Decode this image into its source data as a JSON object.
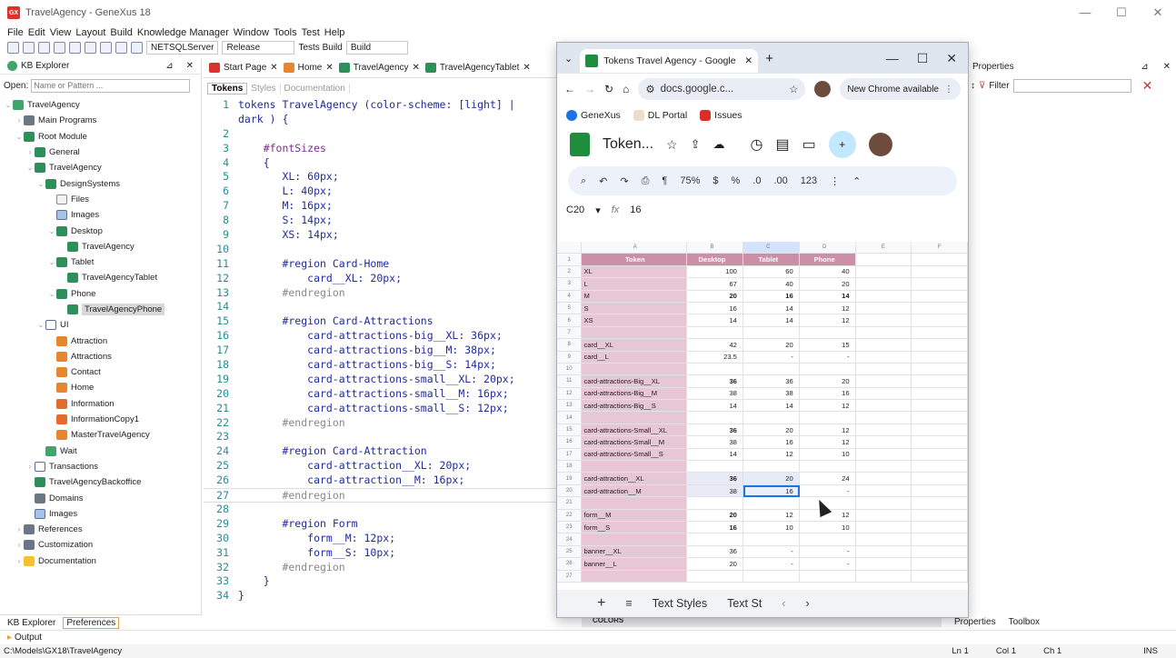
{
  "window": {
    "title": "TravelAgency - GeneXus 18",
    "app_icon": "GX"
  },
  "menu": [
    "File",
    "Edit",
    "View",
    "Layout",
    "Build",
    "Knowledge Manager",
    "Window",
    "Tools",
    "Test",
    "Help"
  ],
  "toolbar": {
    "server": "NETSQLServer",
    "config": "Release",
    "build": "Tests Build",
    "build_sel": "Build"
  },
  "kb_explorer": {
    "title": "KB Explorer",
    "open_label": "Open:",
    "open_placeholder": "Name or Pattern ...",
    "tree": [
      {
        "label": "TravelAgency",
        "level": 0,
        "icon": "kb-icon",
        "chev": "⌄"
      },
      {
        "label": "Main Programs",
        "level": 1,
        "icon": "main-programs-icon",
        "chev": "›"
      },
      {
        "label": "Root Module",
        "level": 1,
        "icon": "module-icon",
        "chev": "⌄"
      },
      {
        "label": "General",
        "level": 2,
        "icon": "module-icon",
        "chev": "›"
      },
      {
        "label": "TravelAgency",
        "level": 2,
        "icon": "module-icon",
        "chev": "⌄"
      },
      {
        "label": "DesignSystems",
        "level": 3,
        "icon": "module-icon",
        "chev": "⌄"
      },
      {
        "label": "Files",
        "level": 4,
        "icon": "file-icon",
        "chev": ""
      },
      {
        "label": "Images",
        "level": 4,
        "icon": "image-icon",
        "chev": ""
      },
      {
        "label": "Desktop",
        "level": 4,
        "icon": "module-icon",
        "chev": "⌄"
      },
      {
        "label": "TravelAgency",
        "level": 5,
        "icon": "design-system-icon",
        "chev": ""
      },
      {
        "label": "Tablet",
        "level": 4,
        "icon": "module-icon",
        "chev": "⌄"
      },
      {
        "label": "TravelAgencyTablet",
        "level": 5,
        "icon": "design-system-icon",
        "chev": ""
      },
      {
        "label": "Phone",
        "level": 4,
        "icon": "module-icon",
        "chev": "⌄"
      },
      {
        "label": "TravelAgencyPhone",
        "level": 5,
        "icon": "design-system-icon",
        "chev": "",
        "selected": true
      },
      {
        "label": "UI",
        "level": 3,
        "icon": "folder-icon",
        "chev": "⌄"
      },
      {
        "label": "Attraction",
        "level": 4,
        "icon": "panel-icon",
        "chev": ""
      },
      {
        "label": "Attractions",
        "level": 4,
        "icon": "panel-icon",
        "chev": ""
      },
      {
        "label": "Contact",
        "level": 4,
        "icon": "panel-icon",
        "chev": ""
      },
      {
        "label": "Home",
        "level": 4,
        "icon": "panel-icon",
        "chev": ""
      },
      {
        "label": "Information",
        "level": 4,
        "icon": "information-icon",
        "chev": ""
      },
      {
        "label": "InformationCopy1",
        "level": 4,
        "icon": "information-icon",
        "chev": ""
      },
      {
        "label": "MasterTravelAgency",
        "level": 4,
        "icon": "panel-icon",
        "chev": ""
      },
      {
        "label": "Wait",
        "level": 3,
        "icon": "wait-icon",
        "chev": ""
      },
      {
        "label": "Transactions",
        "level": 2,
        "icon": "folder-icon",
        "chev": "›"
      },
      {
        "label": "TravelAgencyBackoffice",
        "level": 2,
        "icon": "design-system-icon",
        "chev": ""
      },
      {
        "label": "Domains",
        "level": 2,
        "icon": "domains-icon",
        "chev": ""
      },
      {
        "label": "Images",
        "level": 2,
        "icon": "image-icon",
        "chev": ""
      },
      {
        "label": "References",
        "level": 1,
        "icon": "references-icon",
        "chev": "›"
      },
      {
        "label": "Customization",
        "level": 1,
        "icon": "customization-icon",
        "chev": "›"
      },
      {
        "label": "Documentation",
        "level": 1,
        "icon": "documentation-icon",
        "chev": "›"
      }
    ],
    "bottom_tabs": [
      "KB Explorer",
      "Preferences"
    ]
  },
  "editor": {
    "tabs": [
      "Start Page",
      "Home",
      "TravelAgency",
      "TravelAgencyTablet"
    ],
    "sub_tabs": [
      "Tokens",
      "Styles",
      "Documentation"
    ],
    "lines": [
      {
        "n": "1",
        "t": "tokens TravelAgency (color-scheme: [light] |",
        "c": false
      },
      {
        "n": "",
        "t": "dark ) {",
        "c": false
      },
      {
        "n": "2",
        "t": "",
        "c": false
      },
      {
        "n": "3",
        "t": "    #fontSizes",
        "c": false,
        "kw": true
      },
      {
        "n": "4",
        "t": "    {",
        "c": false
      },
      {
        "n": "5",
        "t": "       XL: 60px;",
        "c": false
      },
      {
        "n": "6",
        "t": "       L: 40px;",
        "c": false
      },
      {
        "n": "7",
        "t": "       M: 16px;",
        "c": false
      },
      {
        "n": "8",
        "t": "       S: 14px;",
        "c": false
      },
      {
        "n": "9",
        "t": "       XS: 14px;",
        "c": false
      },
      {
        "n": "10",
        "t": "",
        "c": false
      },
      {
        "n": "11",
        "t": "       #region Card-Home",
        "c": false
      },
      {
        "n": "12",
        "t": "           card__XL: 20px;",
        "c": false
      },
      {
        "n": "13",
        "t": "       #endregion",
        "c": true
      },
      {
        "n": "14",
        "t": "",
        "c": false
      },
      {
        "n": "15",
        "t": "       #region Card-Attractions",
        "c": false
      },
      {
        "n": "16",
        "t": "           card-attractions-big__XL: 36px;",
        "c": false
      },
      {
        "n": "17",
        "t": "           card-attractions-big__M: 38px;",
        "c": false
      },
      {
        "n": "18",
        "t": "           card-attractions-big__S: 14px;",
        "c": false
      },
      {
        "n": "19",
        "t": "           card-attractions-small__XL: 20px;",
        "c": false
      },
      {
        "n": "20",
        "t": "           card-attractions-small__M: 16px;",
        "c": false
      },
      {
        "n": "21",
        "t": "           card-attractions-small__S: 12px;",
        "c": false
      },
      {
        "n": "22",
        "t": "       #endregion",
        "c": true
      },
      {
        "n": "23",
        "t": "",
        "c": false
      },
      {
        "n": "24",
        "t": "       #region Card-Attraction",
        "c": false
      },
      {
        "n": "25",
        "t": "           card-attraction__XL: 20px;",
        "c": false
      },
      {
        "n": "26",
        "t": "           card-attraction__M: 16px;",
        "c": false
      },
      {
        "n": "27",
        "t": "       #endregion",
        "c": true,
        "current": true
      },
      {
        "n": "28",
        "t": "",
        "c": false
      },
      {
        "n": "29",
        "t": "       #region Form",
        "c": false
      },
      {
        "n": "30",
        "t": "           form__M: 12px;",
        "c": false
      },
      {
        "n": "31",
        "t": "           form__S: 10px;",
        "c": false
      },
      {
        "n": "32",
        "t": "       #endregion",
        "c": true
      },
      {
        "n": "33",
        "t": "    }",
        "c": false
      },
      {
        "n": "34",
        "t": "}",
        "c": false
      }
    ]
  },
  "properties": {
    "title": "Properties",
    "filter_label": "Filter",
    "bottom_tabs": [
      "Properties",
      "Toolbox"
    ]
  },
  "colors_bar": "COLORS",
  "chrome": {
    "tab_title": "Tokens Travel Agency - Google",
    "url": "docs.google.c...",
    "new_chrome": "New Chrome available",
    "bookmarks": [
      "GeneXus",
      "DL Portal",
      "Issues"
    ],
    "sheet_title": "Token...",
    "zoom": "75%",
    "cell_ref": "C20",
    "formula": "16",
    "bottom": {
      "text_styles": "Text Styles",
      "text_st": "Text St"
    },
    "columns": [
      "A",
      "B",
      "C",
      "D",
      "E",
      "F"
    ],
    "header_row": [
      "Token",
      "Desktop",
      "Tablet",
      "Phone"
    ],
    "rows": [
      {
        "n": "2",
        "a": "XL",
        "b": "100",
        "c": "60",
        "d": "40"
      },
      {
        "n": "3",
        "a": "L",
        "b": "67",
        "c": "40",
        "d": "20"
      },
      {
        "n": "4",
        "a": "M",
        "b": "20",
        "c": "16",
        "d": "14",
        "bold": true
      },
      {
        "n": "5",
        "a": "S",
        "b": "16",
        "c": "14",
        "d": "12"
      },
      {
        "n": "6",
        "a": "XS",
        "b": "14",
        "c": "14",
        "d": "12"
      },
      {
        "n": "7",
        "a": "",
        "b": "",
        "c": "",
        "d": ""
      },
      {
        "n": "8",
        "a": "card__XL",
        "b": "42",
        "c": "20",
        "d": "15"
      },
      {
        "n": "9",
        "a": "card__L",
        "b": "23.5",
        "c": "-",
        "d": "-"
      },
      {
        "n": "10",
        "a": "",
        "b": "",
        "c": "",
        "d": ""
      },
      {
        "n": "11",
        "a": "card-attractions-Big__XL",
        "b": "36",
        "c": "36",
        "d": "20",
        "bb": true
      },
      {
        "n": "12",
        "a": "card-attractions-Big__M",
        "b": "38",
        "c": "38",
        "d": "16"
      },
      {
        "n": "13",
        "a": "card-attractions-Big__S",
        "b": "14",
        "c": "14",
        "d": "12"
      },
      {
        "n": "14",
        "a": "",
        "b": "",
        "c": "",
        "d": ""
      },
      {
        "n": "15",
        "a": "card-attractions-Small__XL",
        "b": "36",
        "c": "20",
        "d": "12",
        "bb": true
      },
      {
        "n": "16",
        "a": "card-attractions-Small__M",
        "b": "38",
        "c": "16",
        "d": "12"
      },
      {
        "n": "17",
        "a": "card-attractions-Small__S",
        "b": "14",
        "c": "12",
        "d": "10"
      },
      {
        "n": "18",
        "a": "",
        "b": "",
        "c": "",
        "d": ""
      },
      {
        "n": "19",
        "a": "card-attraction__XL",
        "b": "36",
        "c": "20",
        "d": "24",
        "bb": true,
        "hl": true
      },
      {
        "n": "20",
        "a": "card-attraction__M",
        "b": "38",
        "c": "16",
        "d": "-",
        "sel": true
      },
      {
        "n": "21",
        "a": "",
        "b": "",
        "c": "",
        "d": ""
      },
      {
        "n": "22",
        "a": "form__M",
        "b": "20",
        "c": "12",
        "d": "12",
        "bb": true
      },
      {
        "n": "23",
        "a": "form__S",
        "b": "16",
        "c": "10",
        "d": "10",
        "bb": true
      },
      {
        "n": "24",
        "a": "",
        "b": "",
        "c": "",
        "d": ""
      },
      {
        "n": "25",
        "a": "banner__XL",
        "b": "36",
        "c": "-",
        "d": "-"
      },
      {
        "n": "26",
        "a": "banner__L",
        "b": "20",
        "c": "-",
        "d": "-"
      },
      {
        "n": "27",
        "a": "",
        "b": "",
        "c": "",
        "d": ""
      }
    ]
  },
  "output_label": "Output",
  "status": {
    "path": "C:\\Models\\GX18\\TravelAgency",
    "ln": "Ln 1",
    "col": "Col 1",
    "ch": "Ch 1",
    "ins": "INS"
  }
}
